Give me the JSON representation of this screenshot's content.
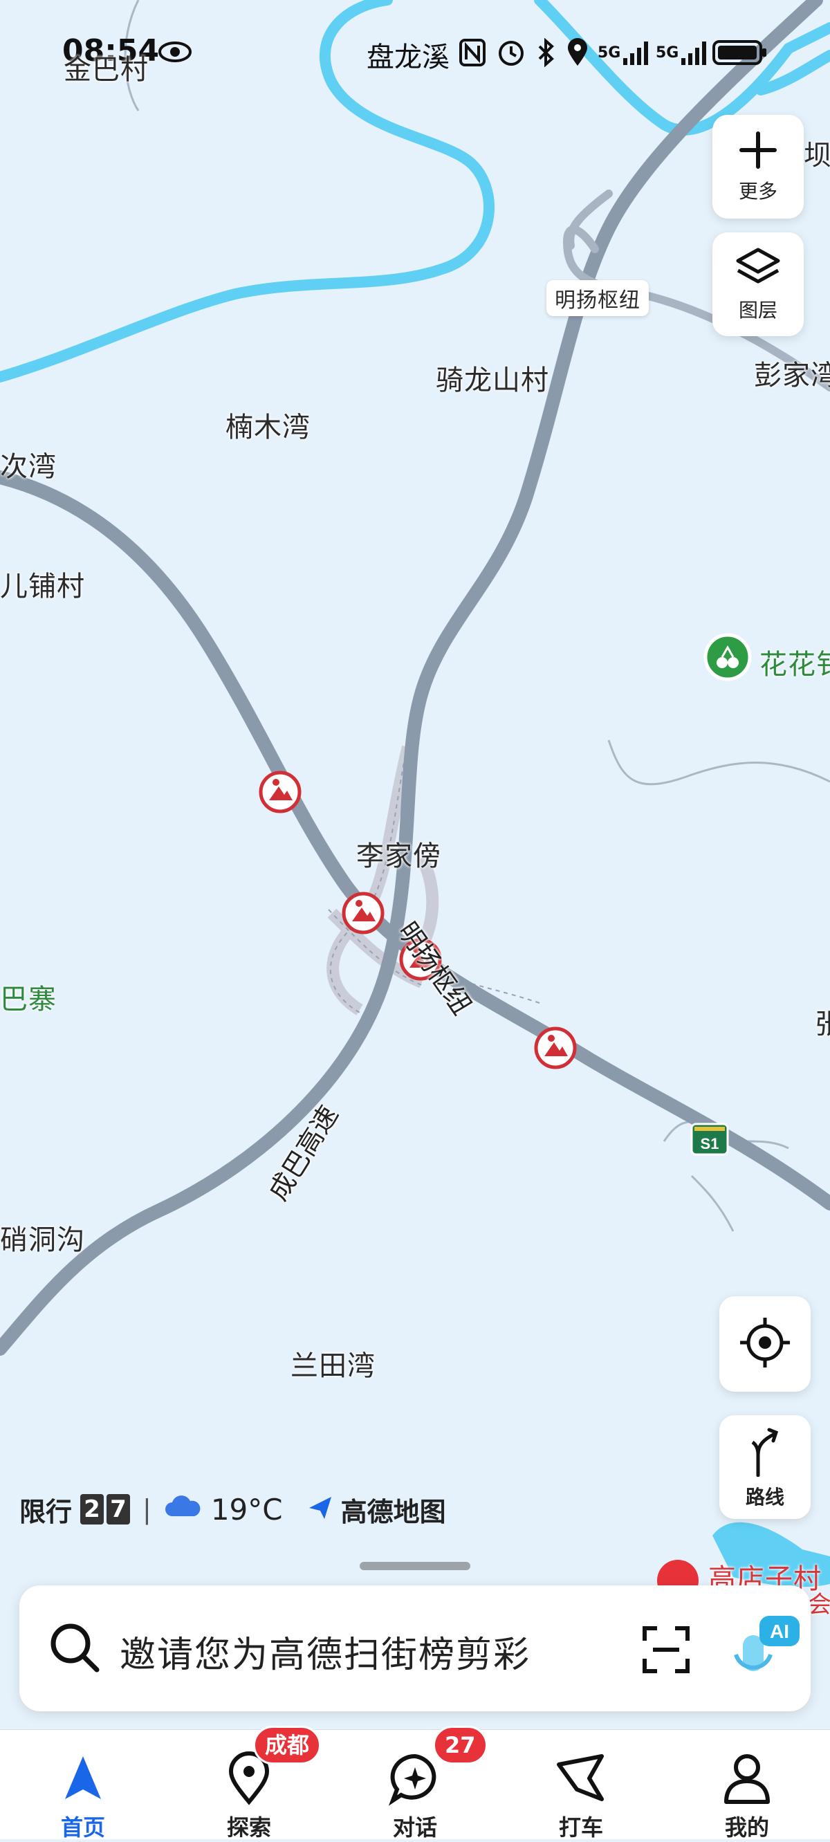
{
  "status": {
    "time": "08:54",
    "location": "盘龙溪",
    "network1": "5G",
    "network2": "5G"
  },
  "map": {
    "labels": {
      "jinba": "金巴村",
      "ba_partial": "坝",
      "minyang_top": "明扬枢纽",
      "qilongshan": "骑龙山村",
      "pengjia": "彭家湾",
      "nanmu": "楠木湾",
      "ciwan": "次湾",
      "erpu": "儿铺村",
      "huahua": "花花钅",
      "lijiabang": "李家傍",
      "minyang_road": "明扬枢纽",
      "bazhai": "巴寨",
      "zhang_partial": "张",
      "shuoshoudong": "硝洞沟",
      "chengba": "成巴高速",
      "lantian": "兰田湾",
      "gaodianzi": "高店子村",
      "hui_partial": "会",
      "highway_shield": "S1"
    },
    "construction_markers": 4
  },
  "controls": {
    "more_label": "更多",
    "layers_label": "图层",
    "route_label": "路线"
  },
  "info": {
    "restriction_label": "限行",
    "restriction_digits": [
      "2",
      "7"
    ],
    "separator": "|",
    "temperature": "19°C",
    "brand": "高德地图"
  },
  "search": {
    "placeholder": "邀请您为高德扫街榜剪彩",
    "ai_label": "AI"
  },
  "tabs": [
    {
      "label": "首页",
      "icon": "navigation-arrow-icon",
      "active": true
    },
    {
      "label": "探索",
      "icon": "location-pin-icon",
      "badge": "成都"
    },
    {
      "label": "对话",
      "icon": "chat-sparkle-icon",
      "badge": "27"
    },
    {
      "label": "打车",
      "icon": "taxi-flag-icon"
    },
    {
      "label": "我的",
      "icon": "person-icon"
    }
  ],
  "colors": {
    "accent": "#1a66e8",
    "water": "#5fd0f3",
    "road": "#8a9aab",
    "badge": "#e8323a",
    "construction": "#d02f35"
  }
}
